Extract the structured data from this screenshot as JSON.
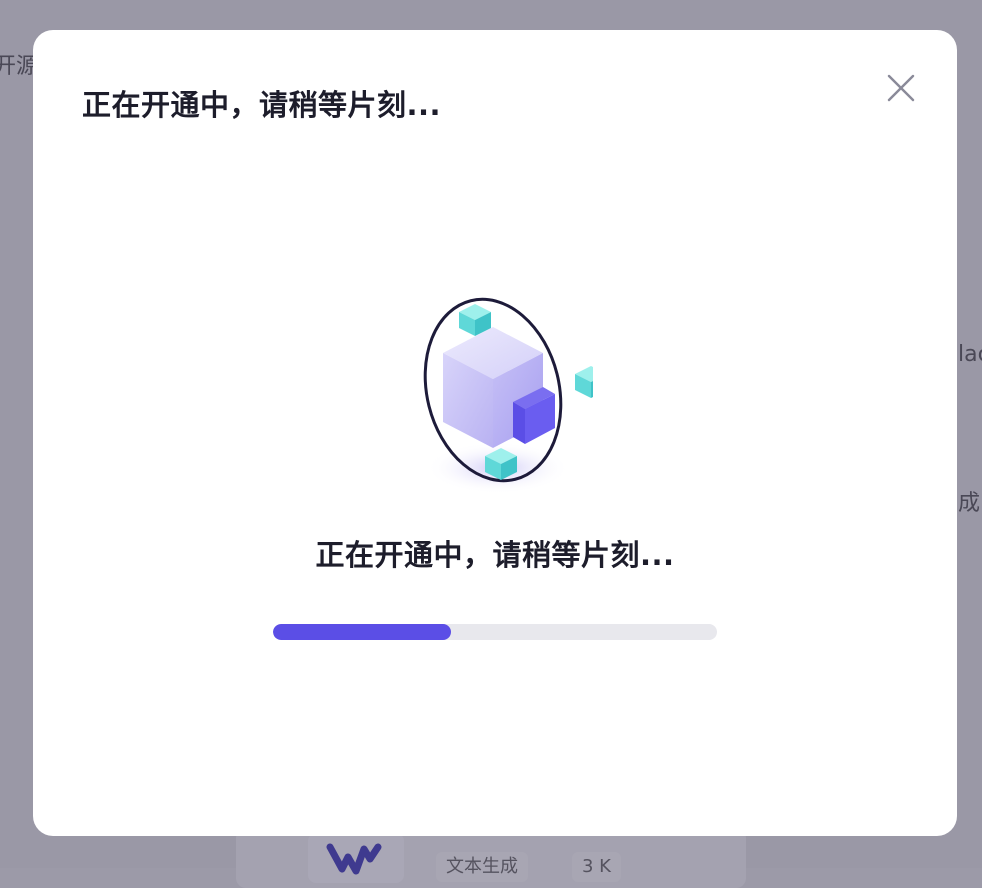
{
  "background": {
    "left_text": "开源",
    "right_text_1": "lac",
    "right_text_2": "成",
    "chip_1": "文本生成",
    "chip_2": "3 K"
  },
  "modal": {
    "title": "正在开通中，请稍等片刻...",
    "close_icon": "close-icon",
    "illustration_icon": "cube-orbit-icon",
    "status_text": "正在开通中，请稍等片刻...",
    "progress": 0.4
  },
  "colors": {
    "accent": "#5b4ee6",
    "cube_teal": "#5fd8d8",
    "track": "#e8e8ed",
    "overlay": "#9a98a6"
  }
}
